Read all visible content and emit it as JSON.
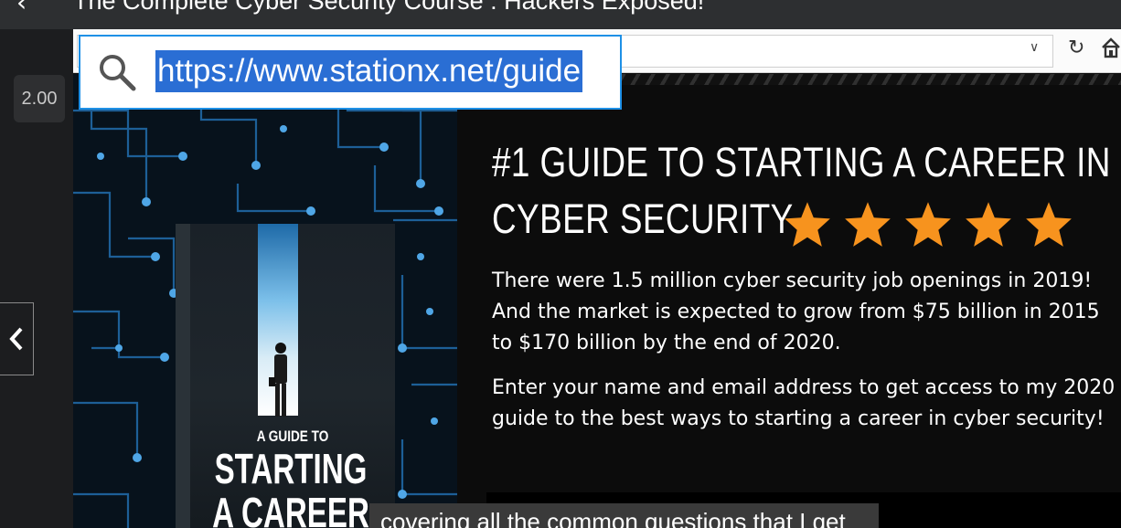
{
  "player": {
    "course_title": "The Complete Cyber Security Course : Hackers Exposed!",
    "back_icon": "chevron-left-icon",
    "speed": "2.00",
    "prev_icon": "chevron-left-icon"
  },
  "browser": {
    "url": "https://www.stationx.net/guide",
    "magnifier_icon": "search-icon",
    "dropdown_icon": "chevron-down-icon",
    "reload_icon": "reload-icon",
    "home_icon": "home-icon"
  },
  "page": {
    "headline_line1": "#1 GUIDE TO STARTING A CAREER IN",
    "headline_line2": "CYBER SECURITY",
    "rating_stars": 5,
    "star_color": "#f7931e",
    "para1": "There were 1.5 million cyber security job openings in 2019! And the market is expected to grow from $75 billion in 2015 to $170 billion by the end of 2020.",
    "para2": "Enter your name and email address to get access to my 2020 guide to the best ways to starting a career in cyber security!",
    "book": {
      "small_title": "A GUIDE TO",
      "big_line1": "STARTING",
      "big_line2": "A CAREER"
    }
  },
  "caption": "covering all the common questions that I get"
}
